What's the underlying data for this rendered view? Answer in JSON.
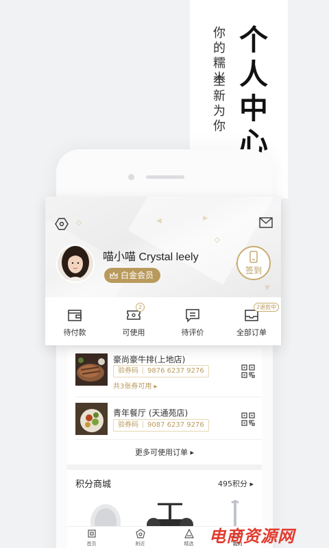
{
  "hero": {
    "tagline_line1": [
      "你",
      "的",
      "糯",
      "米"
    ],
    "tagline_line2": [
      "全",
      "新",
      "为",
      "你"
    ],
    "title_chars": [
      "个",
      "人",
      "中",
      "心"
    ]
  },
  "profile": {
    "username": "喵小喵 Crystal leely",
    "member_level": "白金会员",
    "signin_label": "签到"
  },
  "orders": [
    {
      "label": "待付款",
      "icon": "wallet-icon",
      "badge": ""
    },
    {
      "label": "可使用",
      "icon": "ticket-icon",
      "badge": "2"
    },
    {
      "label": "待评价",
      "icon": "review-icon",
      "badge": ""
    },
    {
      "label": "全部订单",
      "icon": "orders-icon",
      "badge": "2退款中"
    }
  ],
  "coupons": [
    {
      "title": "豪尚豪牛排(上地店)",
      "code_label": "验券码",
      "code": "9876 6237 9276",
      "available": "共3张券可用 ▸"
    },
    {
      "title": "青年餐厅 (天通苑店)",
      "code_label": "验券码",
      "code": "9087 6237 9276",
      "available": ""
    }
  ],
  "more_orders": "更多可使用订单 ▸",
  "points_mall": {
    "title": "积分商城",
    "points": "495积分 ▸"
  },
  "tabbar": [
    {
      "label": "首页",
      "icon": "home-icon",
      "active": false
    },
    {
      "label": "附近",
      "icon": "nearby-icon",
      "active": false
    },
    {
      "label": "精选",
      "icon": "featured-icon",
      "active": false
    },
    {
      "label": "我的",
      "icon": "profile-icon",
      "active": true
    }
  ],
  "watermark": "电商资源网",
  "colors": {
    "accent_gold": "#b99a5c",
    "watermark_red": "#e23a2e"
  }
}
